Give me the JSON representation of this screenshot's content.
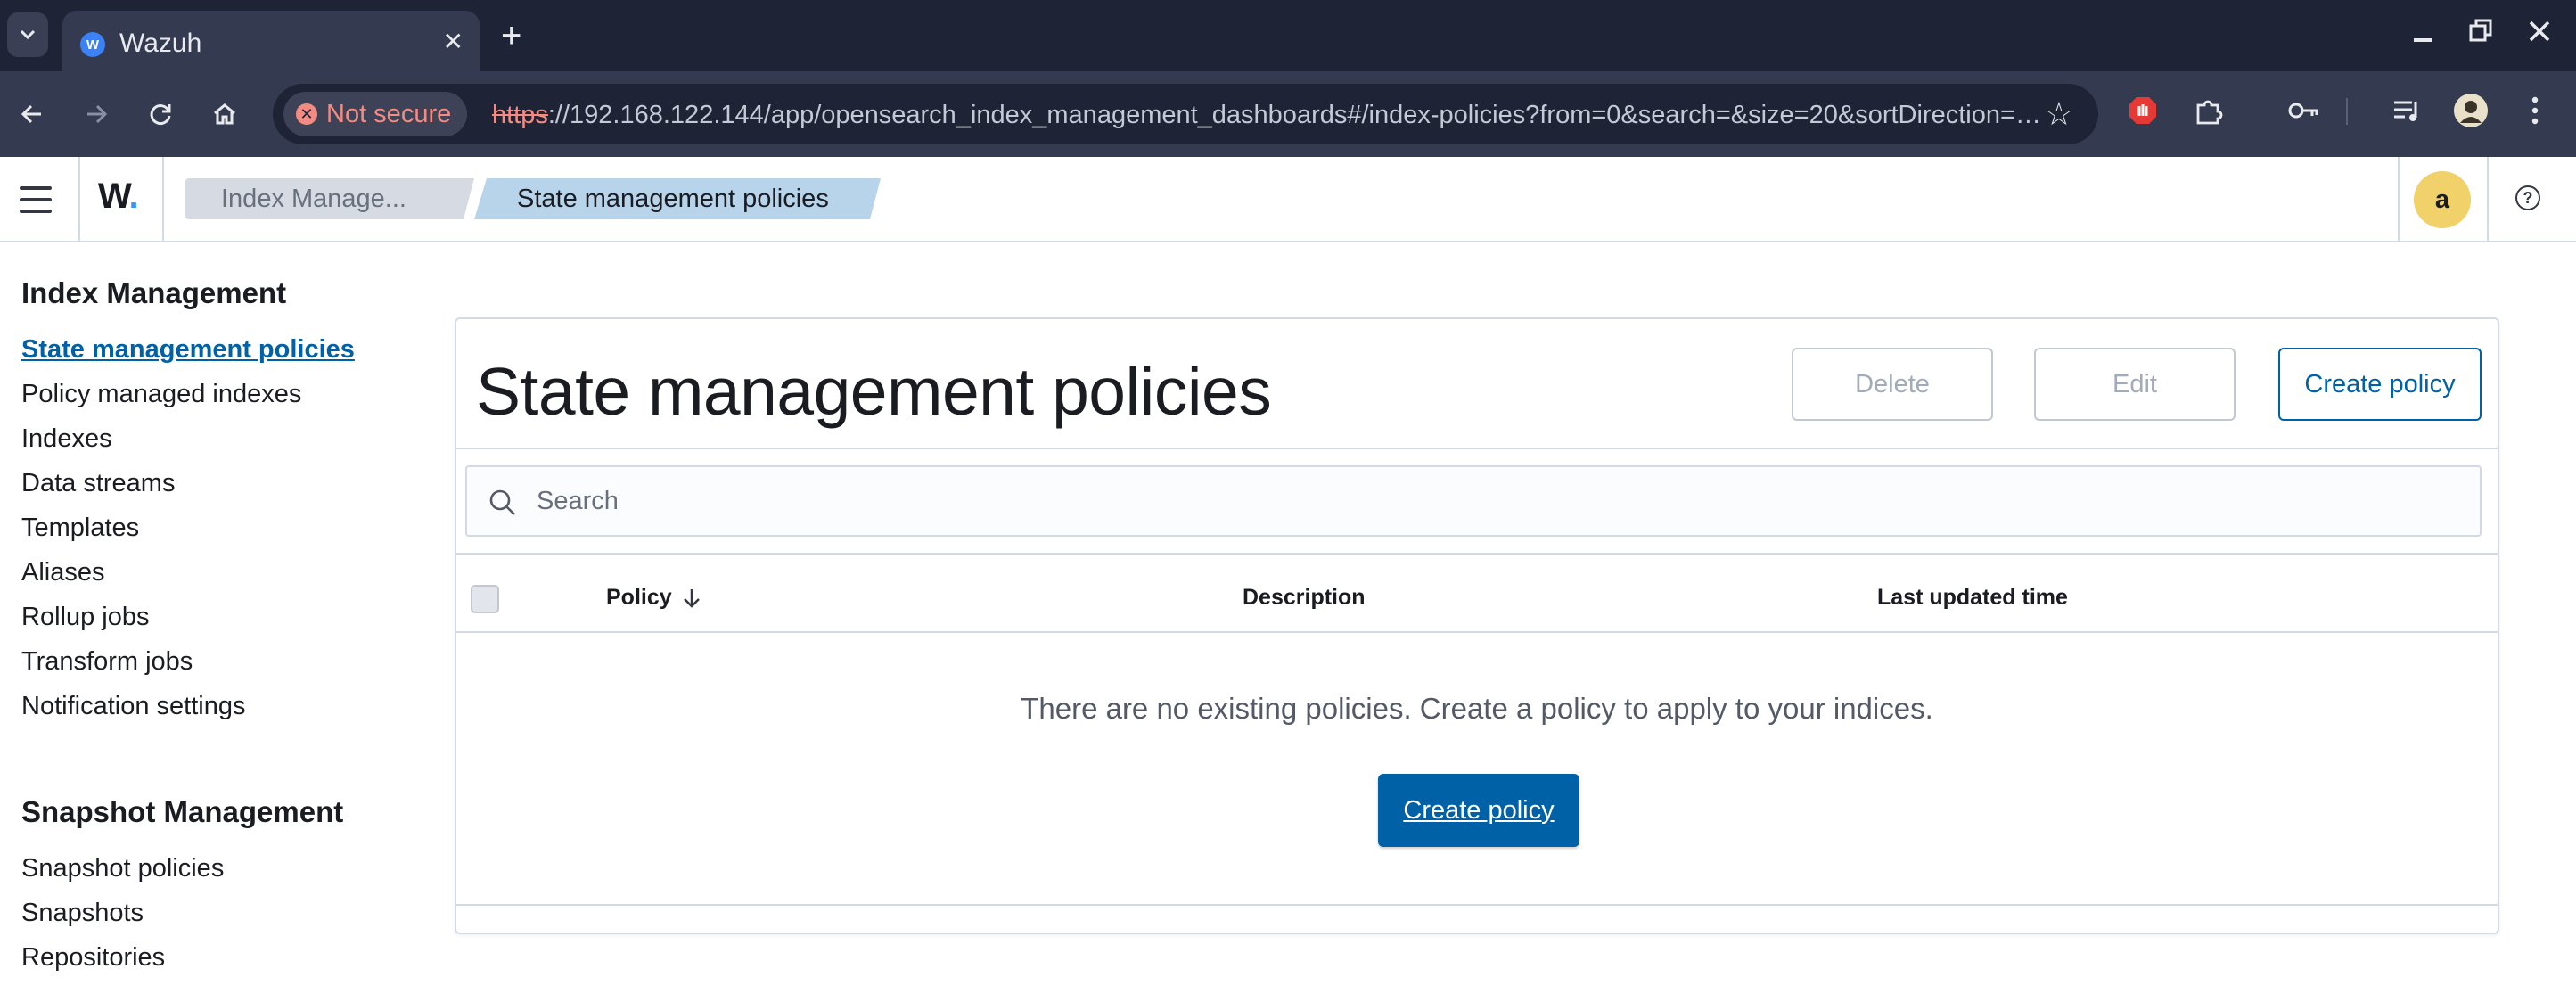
{
  "browser": {
    "tab_title": "Wazuh",
    "tab_favicon_letter": "W",
    "tab_close": "✕",
    "new_tab": "+",
    "security_label": "Not secure",
    "url_scheme": "https",
    "url_rest": "://192.168.122.144/app/opensearch_index_management_dashboards#/index-policies?from=0&search=&size=20&sortDirection=…"
  },
  "header": {
    "logo": "W",
    "logo_dot": ".",
    "breadcrumbs": [
      "Index Manage...",
      "State management policies"
    ],
    "avatar_letter": "a",
    "help": "?"
  },
  "sidebar": {
    "index_title": "Index Management",
    "index_items": [
      "State management policies",
      "Policy managed indexes",
      "Indexes",
      "Data streams",
      "Templates",
      "Aliases",
      "Rollup jobs",
      "Transform jobs",
      "Notification settings"
    ],
    "snapshot_title": "Snapshot Management",
    "snapshot_items": [
      "Snapshot policies",
      "Snapshots",
      "Repositories"
    ]
  },
  "main": {
    "title": "State management policies",
    "buttons": {
      "delete": "Delete",
      "edit": "Edit",
      "create": "Create policy"
    },
    "search_placeholder": "Search",
    "columns": [
      "Policy",
      "Description",
      "Last updated time"
    ],
    "empty_message": "There are no existing policies. Create a policy to apply to your indices.",
    "empty_button": "Create policy"
  },
  "colors": {
    "accent": "#0061a6",
    "chrome_dark": "#1f2336",
    "avatar_bg": "#f0d16a"
  }
}
